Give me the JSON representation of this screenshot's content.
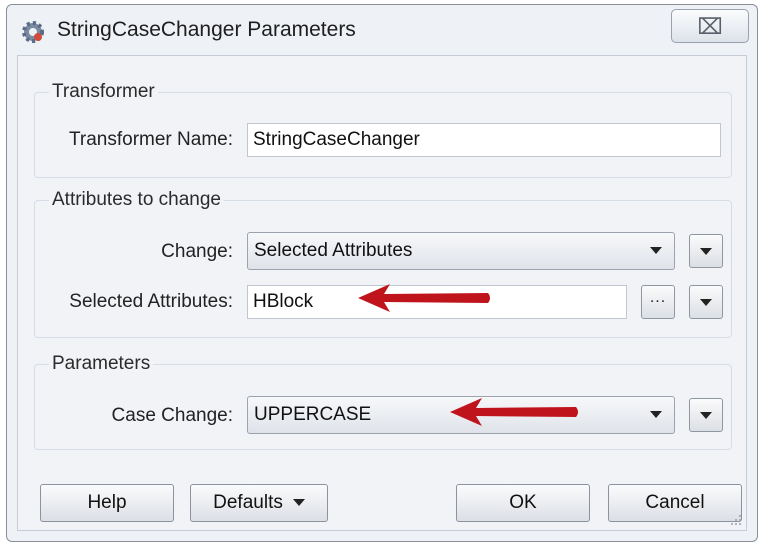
{
  "window": {
    "title": "StringCaseChanger Parameters",
    "close_glyph": "⌧"
  },
  "transformer": {
    "group_title": "Transformer",
    "name_label": "Transformer Name:",
    "name_value": "StringCaseChanger"
  },
  "attributes": {
    "group_title": "Attributes to change",
    "change_label": "Change:",
    "change_value": "Selected Attributes",
    "selected_label": "Selected Attributes:",
    "selected_value": "HBlock",
    "ellipsis": "..."
  },
  "parameters": {
    "group_title": "Parameters",
    "case_label": "Case Change:",
    "case_value": "UPPERCASE"
  },
  "footer": {
    "help": "Help",
    "defaults": "Defaults",
    "ok": "OK",
    "cancel": "Cancel"
  },
  "colors": {
    "annotation_arrow": "#c0141c"
  },
  "icons": [
    "app-gear-icon",
    "close-icon",
    "dropdown-arrow-icon",
    "ellipsis-icon",
    "annotation-arrow",
    "resize-grip-icon"
  ]
}
